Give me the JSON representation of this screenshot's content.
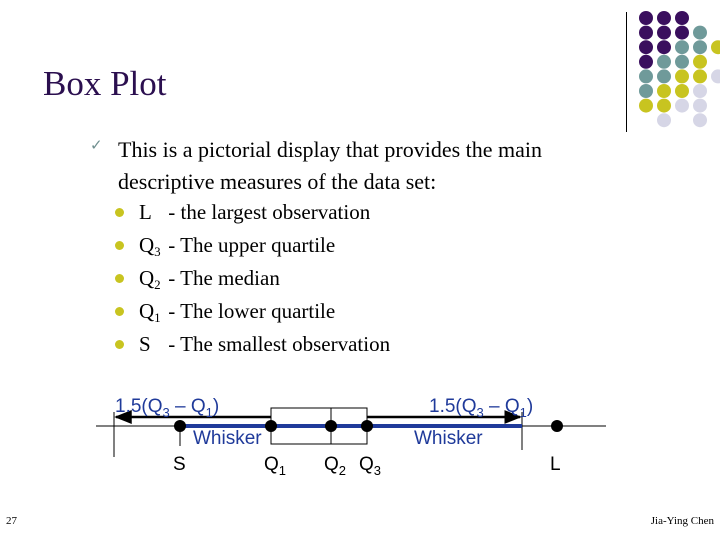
{
  "slide": {
    "title": "Box Plot",
    "intro_text": "This is a pictorial display that provides the main descriptive measures of the data set:",
    "bullets": [
      {
        "symbol": "L",
        "subscript": "",
        "text": " - the largest observation"
      },
      {
        "symbol": "Q",
        "subscript": "3",
        "text": " - The upper quartile"
      },
      {
        "symbol": "Q",
        "subscript": "2",
        "text": " - The median"
      },
      {
        "symbol": "Q",
        "subscript": "1",
        "text": " - The lower quartile"
      },
      {
        "symbol": "S",
        "subscript": "",
        "text": " -  The smallest observation"
      }
    ],
    "page_number": "27",
    "author": "Jia-Ying Chen"
  },
  "colors": {
    "title": "#2b0f4f",
    "bullet": "#c8c420",
    "check": "#6f8f8f",
    "whisker": "#1f3a9a",
    "dot_purple": "#3a0f5e",
    "dot_teal": "#6f9a9a",
    "dot_yellow": "#c8c420",
    "dot_lavender": "#d6d6e6"
  },
  "decor": {
    "dot_grid": [
      "PPP",
      "PPPT",
      "PPTTY",
      "PTTY",
      "TTYYL",
      "TYYL",
      "YYLL",
      "_L_L"
    ]
  },
  "diagram": {
    "left_range_label": {
      "prefix": "1.5(Q",
      "sub_a": "3",
      "mid": " – Q",
      "sub_b": "1",
      "suffix": ")"
    },
    "right_range_label": {
      "prefix": "1.5(Q",
      "sub_a": "3",
      "mid": " – Q",
      "sub_b": "1",
      "suffix": ")"
    },
    "left_whisker_label": "Whisker",
    "right_whisker_label": "Whisker",
    "points": [
      {
        "name": "S",
        "label": "S",
        "sub": ""
      },
      {
        "name": "Q1",
        "label": "Q",
        "sub": "1"
      },
      {
        "name": "Q2",
        "label": "Q",
        "sub": "2"
      },
      {
        "name": "Q3",
        "label": "Q",
        "sub": "3"
      },
      {
        "name": "L",
        "label": "L",
        "sub": ""
      }
    ]
  }
}
